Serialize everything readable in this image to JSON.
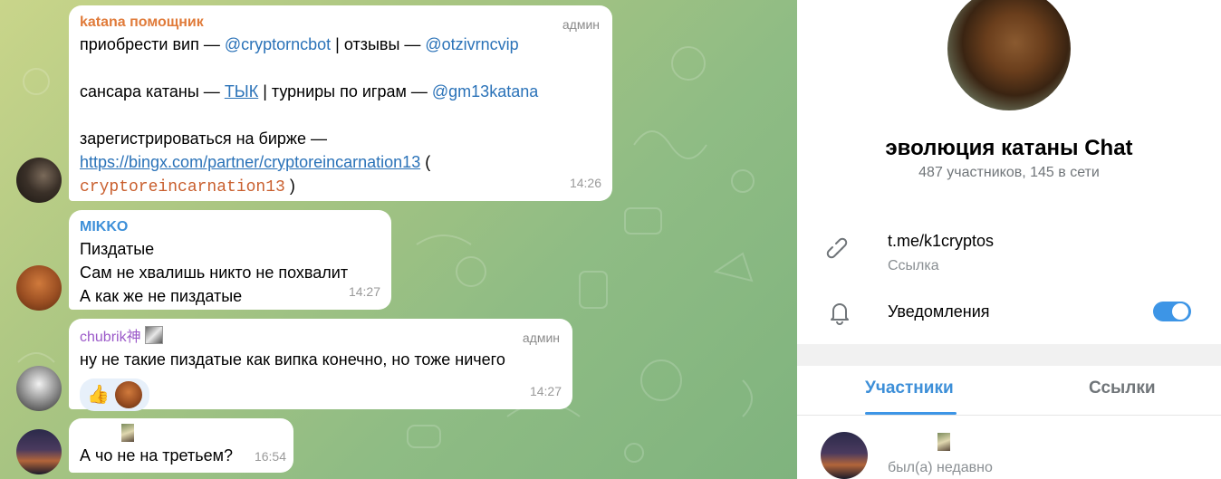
{
  "messages": [
    {
      "sender": "katana помощник",
      "sender_color": "#e07b3a",
      "role": "админ",
      "lines": {
        "l1_pre": "приобрести вип — ",
        "l1_m1": "@cryptorncbot",
        "l1_mid": " | отзывы — ",
        "l1_m2": "@otzivrncvip",
        "l2_pre": "сансара катаны — ",
        "l2_link": "ТЫК",
        "l2_mid": " | турниры по играм — ",
        "l2_m": "@gm13katana",
        "l3": "зарегистрироваться на бирже —",
        "l4_link": "https://bingx.com/partner/cryptoreincarnation13",
        "l4_post": " (",
        "l5_code": "cryptoreincarnation13",
        "l5_post": " )"
      },
      "time": "14:26"
    },
    {
      "sender": "MIKKO",
      "sender_color": "#3d8fd8",
      "lines": [
        "Пиздатые",
        "Сам не хвалишь никто не похвалит",
        "А как же не пиздатые"
      ],
      "time": "14:27"
    },
    {
      "sender": "chubrik神",
      "sender_color": "#9b59c9",
      "role": "админ",
      "text": "ну не такие пиздатые как випка конечно, но тоже ничего",
      "reactions": [
        "👍"
      ],
      "time": "14:27"
    },
    {
      "text": "А чо не на третьем?",
      "time": "16:54"
    }
  ],
  "panel": {
    "group_title": "эволюция катаны Chat",
    "group_subtitle": "487 участников, 145 в сети",
    "link_value": "t.me/k1cryptos",
    "link_label": "Ссылка",
    "notifications_label": "Уведомления",
    "notifications_on": true,
    "tabs": [
      "Участники",
      "Ссылки"
    ],
    "member_status": "был(а) недавно"
  },
  "colors": {
    "accent": "#3d95e6",
    "bubble": "#ffffff"
  }
}
